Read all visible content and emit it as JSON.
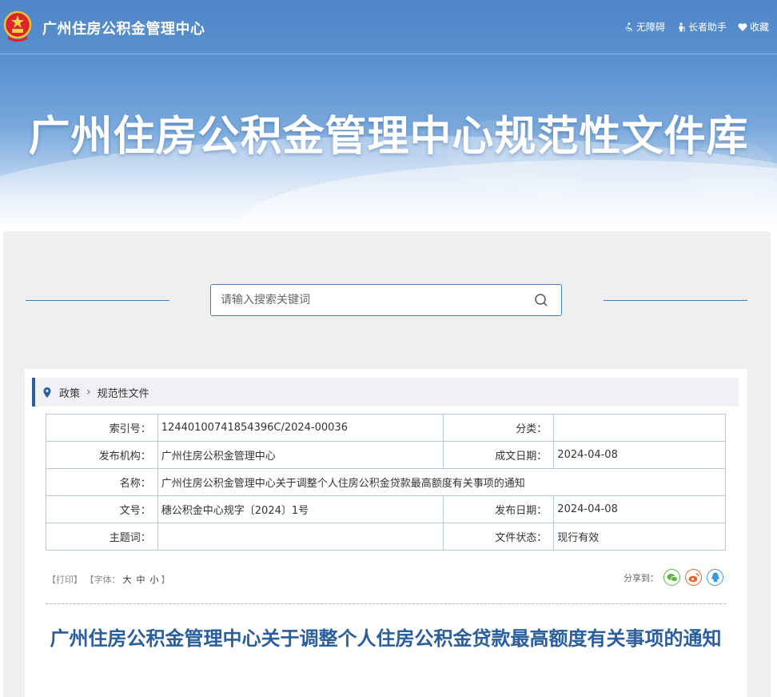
{
  "header": {
    "site_name": "广州住房公积金管理中心",
    "tools": [
      {
        "label": "无障碍",
        "icon": "wheelchair-icon"
      },
      {
        "label": "长者助手",
        "icon": "elder-icon"
      },
      {
        "label": "收藏",
        "icon": "heart-icon"
      }
    ]
  },
  "banner": {
    "title": "广州住房公积金管理中心规范性文件库"
  },
  "search": {
    "placeholder": "请输入搜索关键词",
    "value": ""
  },
  "breadcrumb": {
    "items": [
      "政策",
      "规范性文件"
    ]
  },
  "meta": {
    "index_label": "索引号：",
    "index_value": "12440100741854396C/2024-00036",
    "category_label": "分类：",
    "category_value": "",
    "publisher_label": "发布机构：",
    "publisher_value": "广州住房公积金管理中心",
    "date_label": "成文日期：",
    "date_value": "2024-04-08",
    "name_label": "名称：",
    "name_value": "广州住房公积金管理中心关于调整个人住房公积金贷款最高额度有关事项的通知",
    "docno_label": "文号：",
    "docno_value": "穗公积金中心规字〔2024〕1号",
    "pubdate_label": "发布日期：",
    "pubdate_value": "2024-04-08",
    "keywords_label": "主题词：",
    "keywords_value": "",
    "status_label": "文件状态：",
    "status_value": "现行有效"
  },
  "options": {
    "print": "【打印】",
    "font_prefix": "【字体：",
    "font_large": "大",
    "font_medium": "中",
    "font_small": "小",
    "font_suffix": "】"
  },
  "share": {
    "label": "分享到：",
    "targets": [
      "wechat-icon",
      "weibo-icon",
      "qq-icon"
    ]
  },
  "document": {
    "title": "广州住房公积金管理中心关于调整个人住房公积金贷款最高额度有关事项的通知"
  },
  "colors": {
    "accent": "#2a5e9c",
    "border": "#3f7fc4",
    "wechat": "#5fb548",
    "weibo": "#e8612c",
    "qq": "#3a9ad9"
  }
}
